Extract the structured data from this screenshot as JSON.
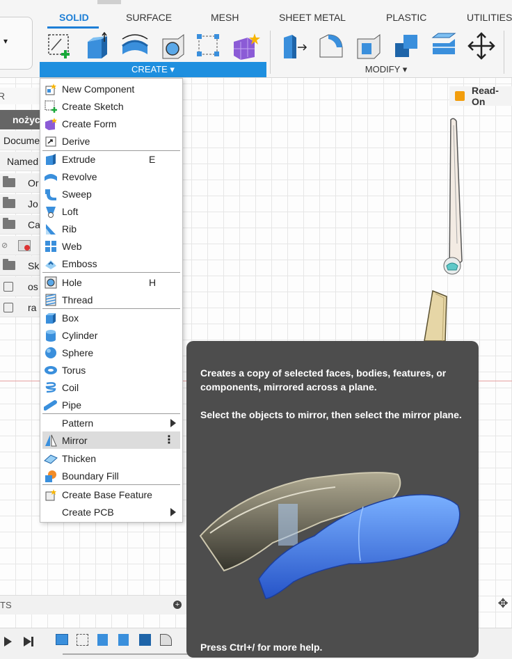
{
  "toolbar": {
    "tabs": [
      {
        "label": "SOLID",
        "active": true
      },
      {
        "label": "SURFACE"
      },
      {
        "label": "MESH"
      },
      {
        "label": "SHEET METAL"
      },
      {
        "label": "PLASTIC"
      },
      {
        "label": "UTILITIES"
      }
    ],
    "create_label": "CREATE ▾",
    "modify_label": "MODIFY ▾",
    "left_arrow": "▾"
  },
  "browser": {
    "search_glyph": "R",
    "doc_name": "nożyc",
    "rows": [
      "Docume",
      "Named",
      "Or",
      "Jo",
      "Ca",
      "",
      "Sk",
      "os",
      "ra"
    ]
  },
  "readonly_label": "Read-On",
  "menu": {
    "items": [
      {
        "label": "New Component"
      },
      {
        "label": "Create Sketch"
      },
      {
        "label": "Create Form"
      },
      {
        "label": "Derive"
      },
      {
        "label": "Extrude",
        "shortcut": "E"
      },
      {
        "label": "Revolve"
      },
      {
        "label": "Sweep"
      },
      {
        "label": "Loft"
      },
      {
        "label": "Rib"
      },
      {
        "label": "Web"
      },
      {
        "label": "Emboss"
      },
      {
        "label": "Hole",
        "shortcut": "H"
      },
      {
        "label": "Thread"
      },
      {
        "label": "Box"
      },
      {
        "label": "Cylinder"
      },
      {
        "label": "Sphere"
      },
      {
        "label": "Torus"
      },
      {
        "label": "Coil"
      },
      {
        "label": "Pipe"
      },
      {
        "label": "Pattern"
      },
      {
        "label": "Mirror"
      },
      {
        "label": "Thicken"
      },
      {
        "label": "Boundary Fill"
      },
      {
        "label": "Create Base Feature"
      },
      {
        "label": "Create PCB"
      }
    ]
  },
  "tooltip": {
    "line1": "Creates a copy of selected faces, bodies, features, or components, mirrored across a plane.",
    "line2": "Select the objects to mirror, then select the mirror plane.",
    "help": "Press Ctrl+/ for more help."
  },
  "comments_label": "TS",
  "colors": {
    "accent": "#1e8fdf",
    "tooltip_bg": "#4d4d4d"
  }
}
